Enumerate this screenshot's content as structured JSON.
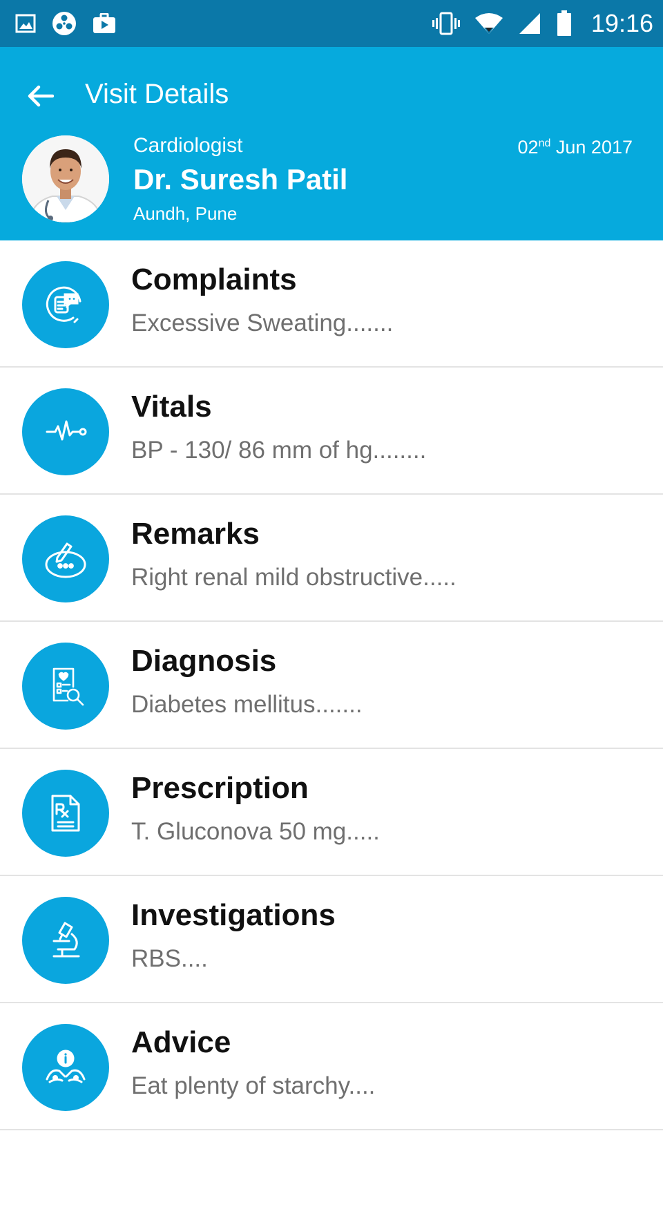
{
  "status_bar": {
    "time": "19:16",
    "left_icons": [
      "gallery-icon",
      "media-reel-icon",
      "briefcase-icon"
    ],
    "right_icons": [
      "vibrate-icon",
      "wifi-icon",
      "cell-signal-icon",
      "battery-icon"
    ]
  },
  "header": {
    "title": "Visit Details",
    "background_color": "#06aadd",
    "doctor": {
      "specialty": "Cardiologist",
      "name": "Dr. Suresh Patil",
      "location": "Aundh, Pune"
    },
    "date": {
      "day": "02",
      "suffix": "nd",
      "month_year": "Jun 2017"
    }
  },
  "accent_color": "#0aa6de",
  "sections": [
    {
      "title": "Complaints",
      "summary": "Excessive Sweating.......",
      "icon": "complaints-chat-icon"
    },
    {
      "title": "Vitals",
      "summary": "BP - 130/ 86 mm of hg........",
      "icon": "heartbeat-icon"
    },
    {
      "title": "Remarks",
      "summary": "Right renal mild obstructive.....",
      "icon": "remarks-pencil-bubble-icon"
    },
    {
      "title": "Diagnosis",
      "summary": "Diabetes mellitus.......",
      "icon": "diagnosis-report-search-icon"
    },
    {
      "title": "Prescription",
      "summary": "T. Gluconova 50 mg.....",
      "icon": "prescription-rx-icon"
    },
    {
      "title": "Investigations",
      "summary": "RBS....",
      "icon": "microscope-icon"
    },
    {
      "title": "Advice",
      "summary": "Eat plenty of starchy....",
      "icon": "advice-info-hands-icon"
    }
  ]
}
